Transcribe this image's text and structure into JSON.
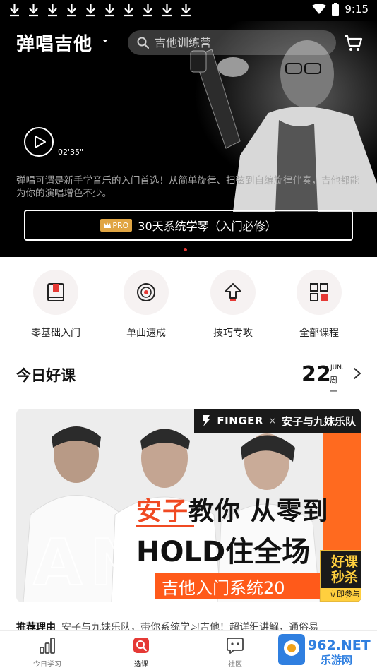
{
  "statusbar": {
    "time": "9:15",
    "download_count": 10
  },
  "header": {
    "title": "弹唱吉他",
    "search_placeholder": "吉他训练营"
  },
  "hero": {
    "duration": "02'35\"",
    "description": "弹唱可谓是新手学音乐的入门首选！从简单旋律、扫弦到自编旋律伴奏，吉他都能为你的演唱增色不少。",
    "cta_badge": "PRO",
    "cta_label": "30天系统学琴（入门必修）"
  },
  "categories": [
    {
      "label": "零基础入门",
      "icon": "book-icon"
    },
    {
      "label": "单曲速成",
      "icon": "vinyl-icon"
    },
    {
      "label": "技巧专攻",
      "icon": "upload-arrow-icon"
    },
    {
      "label": "全部课程",
      "icon": "grid-icon"
    }
  ],
  "today": {
    "title": "今日好课",
    "day": "22",
    "month": "JUN.",
    "weekday": "周一"
  },
  "course": {
    "brand": "FINGER",
    "brand_x": "×",
    "partner": "安子与九妹乐队",
    "headline_red": "安子",
    "headline_rest": "教你 从零到",
    "headline2": "HOLD住全场",
    "ghost_text": "AN",
    "series": "吉他入门系统20",
    "promo_line1": "好课",
    "promo_line2": "秒杀",
    "promo_join": "立即参与"
  },
  "recommend": {
    "label": "推荐理由",
    "text": "安子与九妹乐队，带你系统学习吉他！超详细讲解，通俗易"
  },
  "tabs": [
    {
      "label": "今日学习",
      "icon": "chart-bars-icon",
      "active": false
    },
    {
      "label": "选课",
      "icon": "course-select-icon",
      "active": true
    },
    {
      "label": "社区",
      "icon": "chat-bubble-icon",
      "active": false
    }
  ],
  "watermark": {
    "text_top": "962.NET",
    "text_bottom": "乐游网"
  },
  "colors": {
    "accent": "#e53935",
    "promo_orange": "#ff6a1f",
    "pro_gold": "#e0a543"
  }
}
